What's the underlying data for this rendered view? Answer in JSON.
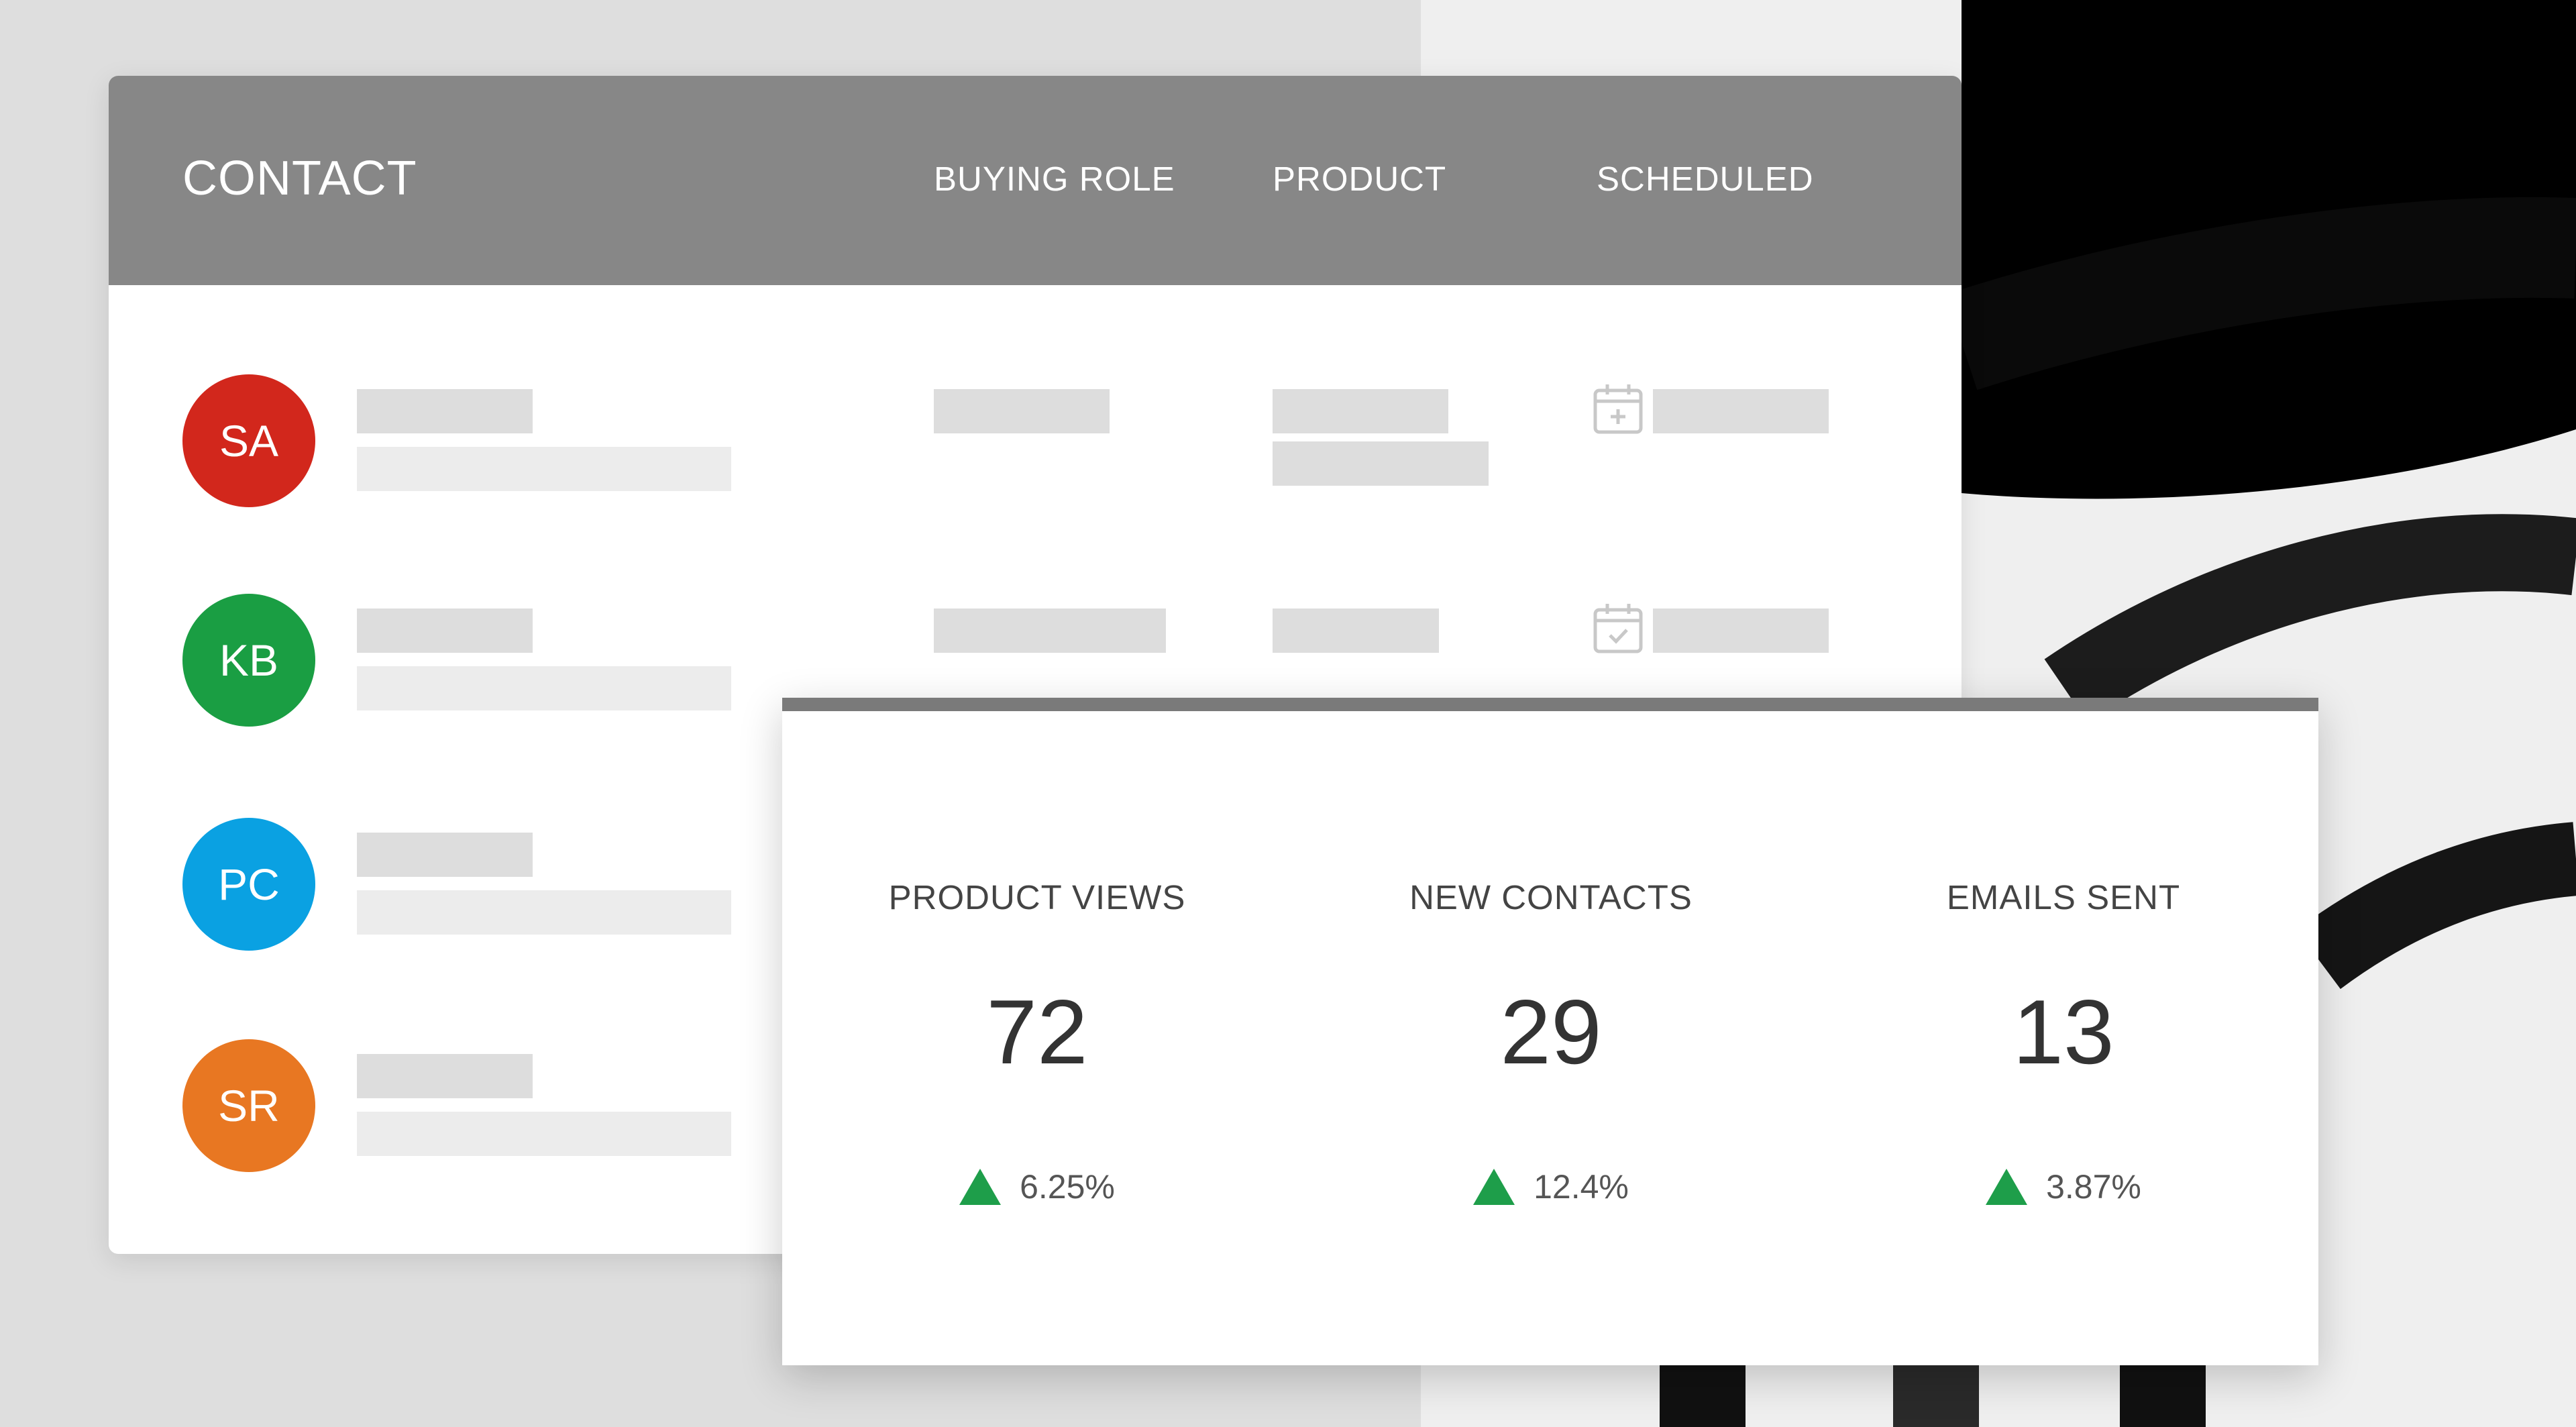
{
  "colors": {
    "header_bg": "#878787",
    "placeholder": "#dddddd",
    "up_arrow": "#1e9e4a"
  },
  "table": {
    "columns": {
      "contact": "CONTACT",
      "buying_role": "BUYING ROLE",
      "product": "PRODUCT",
      "scheduled": "SCHEDULED"
    },
    "rows": [
      {
        "initials": "SA",
        "color": "#d2271c",
        "calendar_icon": "calendar-plus-icon"
      },
      {
        "initials": "KB",
        "color": "#1a9e43",
        "calendar_icon": "calendar-check-icon"
      },
      {
        "initials": "PC",
        "color": "#0aa1e2",
        "calendar_icon": null
      },
      {
        "initials": "SR",
        "color": "#e87722",
        "calendar_icon": null
      }
    ]
  },
  "metrics": [
    {
      "label": "PRODUCT VIEWS",
      "value": "72",
      "change": "6.25%",
      "trend_icon": "triangle-up-icon"
    },
    {
      "label": "NEW CONTACTS",
      "value": "29",
      "change": "12.4%",
      "trend_icon": "triangle-up-icon"
    },
    {
      "label": "EMAILS SENT",
      "value": "13",
      "change": "3.87%",
      "trend_icon": "triangle-up-icon"
    }
  ]
}
